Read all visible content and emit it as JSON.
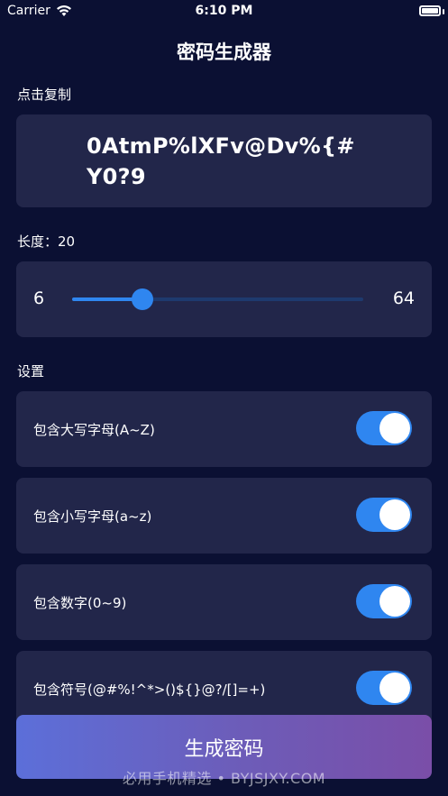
{
  "status_bar": {
    "carrier": "Carrier",
    "time": "6:10 PM"
  },
  "nav": {
    "title": "密码生成器"
  },
  "copy_section": {
    "label": "点击复制",
    "password": "0AtmP%lXFv@Dv%{#Y0?9"
  },
  "length_section": {
    "label": "长度：20",
    "min": "6",
    "max": "64",
    "value": 20
  },
  "settings": {
    "label": "设置",
    "items": [
      {
        "label": "包含大写字母(A~Z)",
        "on": true
      },
      {
        "label": "包含小写字母(a~z)",
        "on": true
      },
      {
        "label": "包含数字(0~9)",
        "on": true
      },
      {
        "label": "包含符号(@#%!^*>()${}@?/[]=+)",
        "on": true
      }
    ]
  },
  "generate_button": {
    "label": "生成密码"
  },
  "watermark": "必用手机精选 • BYJSJXY.COM",
  "colors": {
    "background": "#0b1033",
    "card": "#22264a",
    "accent": "#2f86f0",
    "button_gradient_start": "#5c6fd9",
    "button_gradient_end": "#7a4ea8"
  }
}
